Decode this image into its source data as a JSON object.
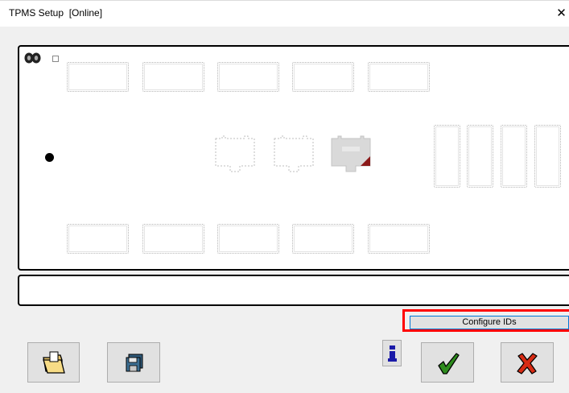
{
  "window": {
    "title": "TPMS Setup  [Online]",
    "close_glyph": "✕"
  },
  "canvas": {
    "legend_icon": "dual-tire-icon",
    "legend_checkbox_checked": false,
    "vehicle_marker": "vehicle-dot"
  },
  "message": {
    "text": ""
  },
  "actions": {
    "configure_ids_label": "Configure IDs",
    "open_icon": "open-folder-icon",
    "save_icon": "save-disk-icon",
    "info_glyph": "i",
    "ok_icon": "checkmark-icon",
    "cancel_icon": "cross-icon"
  },
  "colors": {
    "highlight": "#ff0000",
    "ok_green": "#2e8b1e",
    "cancel_red": "#d82b14",
    "info_blue": "#1a1aa8"
  }
}
